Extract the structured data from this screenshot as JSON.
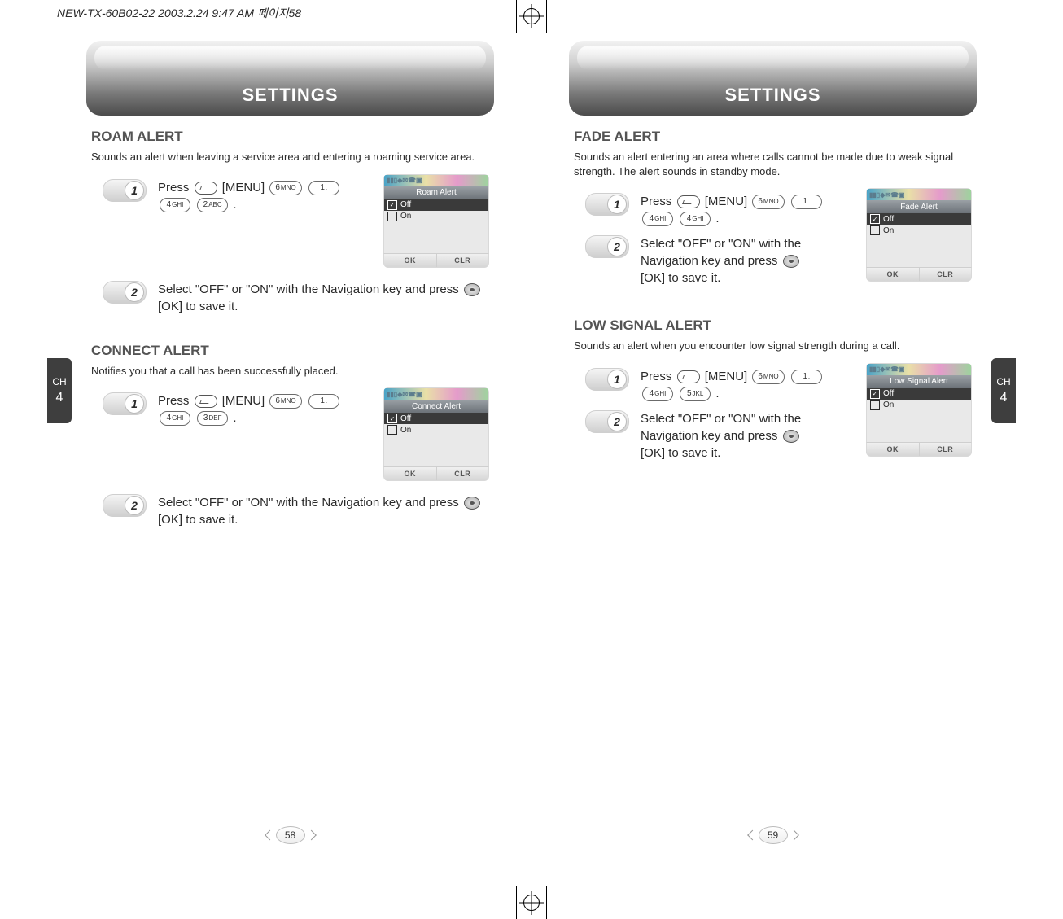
{
  "meta": {
    "slug": "NEW-TX-60B02-22  2003.2.24 9:47 AM  페이지58"
  },
  "chapter": {
    "label": "CH",
    "number": "4"
  },
  "left": {
    "tab_title": "SETTINGS",
    "page_number": "58",
    "sections": {
      "roam": {
        "title": "ROAM ALERT",
        "desc": "Sounds an alert when leaving a service area and entering a roaming service area.",
        "step1_prefix": "Press ",
        "step1_menu": "[MENU]",
        "step1_keys": {
          "a": "6",
          "asub": "MNO",
          "b": "1",
          "bsub": ".",
          "c": "4",
          "csub": "GHI",
          "d": "2",
          "dsub": "ABC"
        },
        "step1_suffix": " .",
        "step2": "Select \"OFF\" or \"ON\" with the Navigation key and press ",
        "step2_ok": "[OK]",
        "step2_suffix": " to save it.",
        "screen": {
          "title": "Roam Alert",
          "off": "Off",
          "on": "On",
          "ok": "OK",
          "clr": "CLR"
        }
      },
      "connect": {
        "title": "CONNECT ALERT",
        "desc": "Notifies you that a call has been successfully placed.",
        "step1_prefix": "Press ",
        "step1_menu": "[MENU]",
        "step1_keys": {
          "a": "6",
          "asub": "MNO",
          "b": "1",
          "bsub": ".",
          "c": "4",
          "csub": "GHI",
          "d": "3",
          "dsub": "DEF"
        },
        "step1_suffix": " .",
        "step2": "Select \"OFF\" or \"ON\" with the Navigation key and press ",
        "step2_ok": "[OK]",
        "step2_suffix": " to save it.",
        "screen": {
          "title": "Connect Alert",
          "off": "Off",
          "on": "On",
          "ok": "OK",
          "clr": "CLR"
        }
      }
    }
  },
  "right": {
    "tab_title": "SETTINGS",
    "page_number": "59",
    "sections": {
      "fade": {
        "title": "FADE ALERT",
        "desc": "Sounds an alert entering an area where calls cannot be made due to weak signal strength. The alert sounds in standby mode.",
        "step1_prefix": "Press ",
        "step1_menu": "[MENU]",
        "step1_keys": {
          "a": "6",
          "asub": "MNO",
          "b": "1",
          "bsub": ".",
          "c": "4",
          "csub": "GHI",
          "d": "4",
          "dsub": "GHI"
        },
        "step1_suffix": " .",
        "step2": "Select \"OFF\" or \"ON\" with the Navigation key and press ",
        "step2_ok": "[OK]",
        "step2_suffix": " to save it.",
        "screen": {
          "title": "Fade Alert",
          "off": "Off",
          "on": "On",
          "ok": "OK",
          "clr": "CLR"
        }
      },
      "low": {
        "title": "LOW SIGNAL ALERT",
        "desc": "Sounds an alert when you encounter low signal strength during a call.",
        "step1_prefix": "Press ",
        "step1_menu": "[MENU]",
        "step1_keys": {
          "a": "6",
          "asub": "MNO",
          "b": "1",
          "bsub": ".",
          "c": "4",
          "csub": "GHI",
          "d": "5",
          "dsub": "JKL"
        },
        "step1_suffix": " .",
        "step2": "Select \"OFF\" or \"ON\" with the Navigation key and press ",
        "step2_ok": "[OK]",
        "step2_suffix": " to save it.",
        "screen": {
          "title": "Low Signal Alert",
          "off": "Off",
          "on": "On",
          "ok": "OK",
          "clr": "CLR"
        }
      }
    }
  }
}
